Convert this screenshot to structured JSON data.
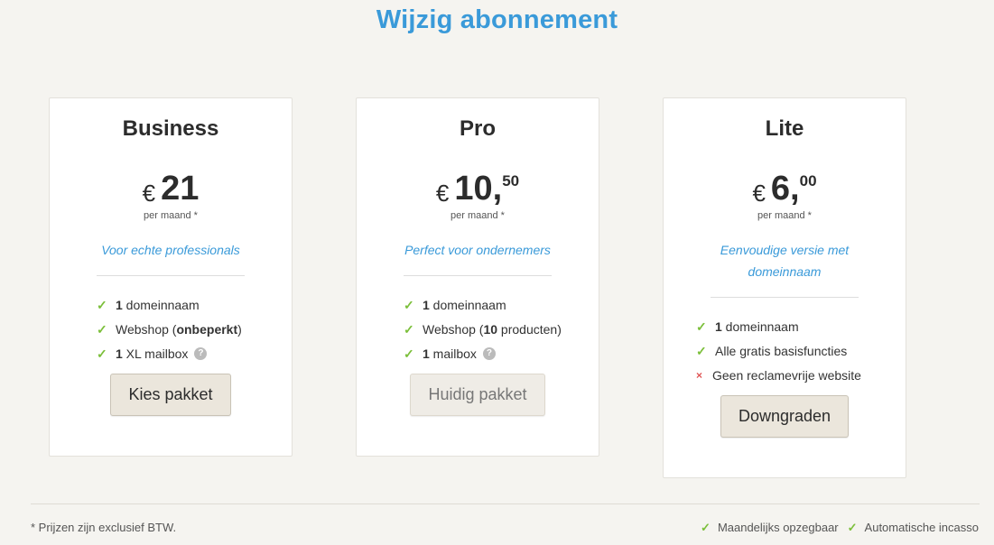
{
  "title": "Wijzig abonnement",
  "plans": [
    {
      "name": "Business",
      "currency": "€",
      "price_main": "21",
      "price_cents": "",
      "per_month": "per maand *",
      "tagline": "Voor echte professionals",
      "features": [
        {
          "icon": "check-icon",
          "bold": "1",
          "text": " domeinnaam"
        },
        {
          "icon": "check-icon",
          "pre": "Webshop (",
          "bold": "onbeperkt",
          "post": ")"
        },
        {
          "icon": "check-icon",
          "bold": "1",
          "text": " XL mailbox",
          "help": "?"
        }
      ],
      "button": "Kies pakket"
    },
    {
      "name": "Pro",
      "currency": "€",
      "price_main": "10,",
      "price_cents": "50",
      "per_month": "per maand *",
      "tagline": "Perfect voor ondernemers",
      "features": [
        {
          "icon": "check-icon",
          "bold": "1",
          "text": " domeinnaam"
        },
        {
          "icon": "check-icon",
          "pre": "Webshop (",
          "bold": "10",
          "post": " producten)"
        },
        {
          "icon": "check-icon",
          "bold": "1",
          "text": " mailbox",
          "help": "?"
        }
      ],
      "button": "Huidig pakket"
    },
    {
      "name": "Lite",
      "currency": "€",
      "price_main": "6,",
      "price_cents": "00",
      "per_month": "per maand *",
      "tagline": "Eenvoudige versie met domeinnaam",
      "features": [
        {
          "icon": "check-icon",
          "bold": "1",
          "text": " domeinnaam"
        },
        {
          "icon": "check-icon",
          "text": "Alle gratis basisfuncties"
        },
        {
          "icon": "cross-icon",
          "text": "Geen reclamevrije website"
        }
      ],
      "button": "Downgraden"
    }
  ],
  "footer": {
    "note": "* Prijzen zijn exclusief BTW.",
    "features": [
      "Maandelijks opzegbaar",
      "Automatische incasso"
    ]
  },
  "colors": {
    "accent": "#3a9ad9",
    "check": "#7bbf3a",
    "cross": "#e05555"
  },
  "check_glyph": "✓",
  "cross_glyph": "×"
}
